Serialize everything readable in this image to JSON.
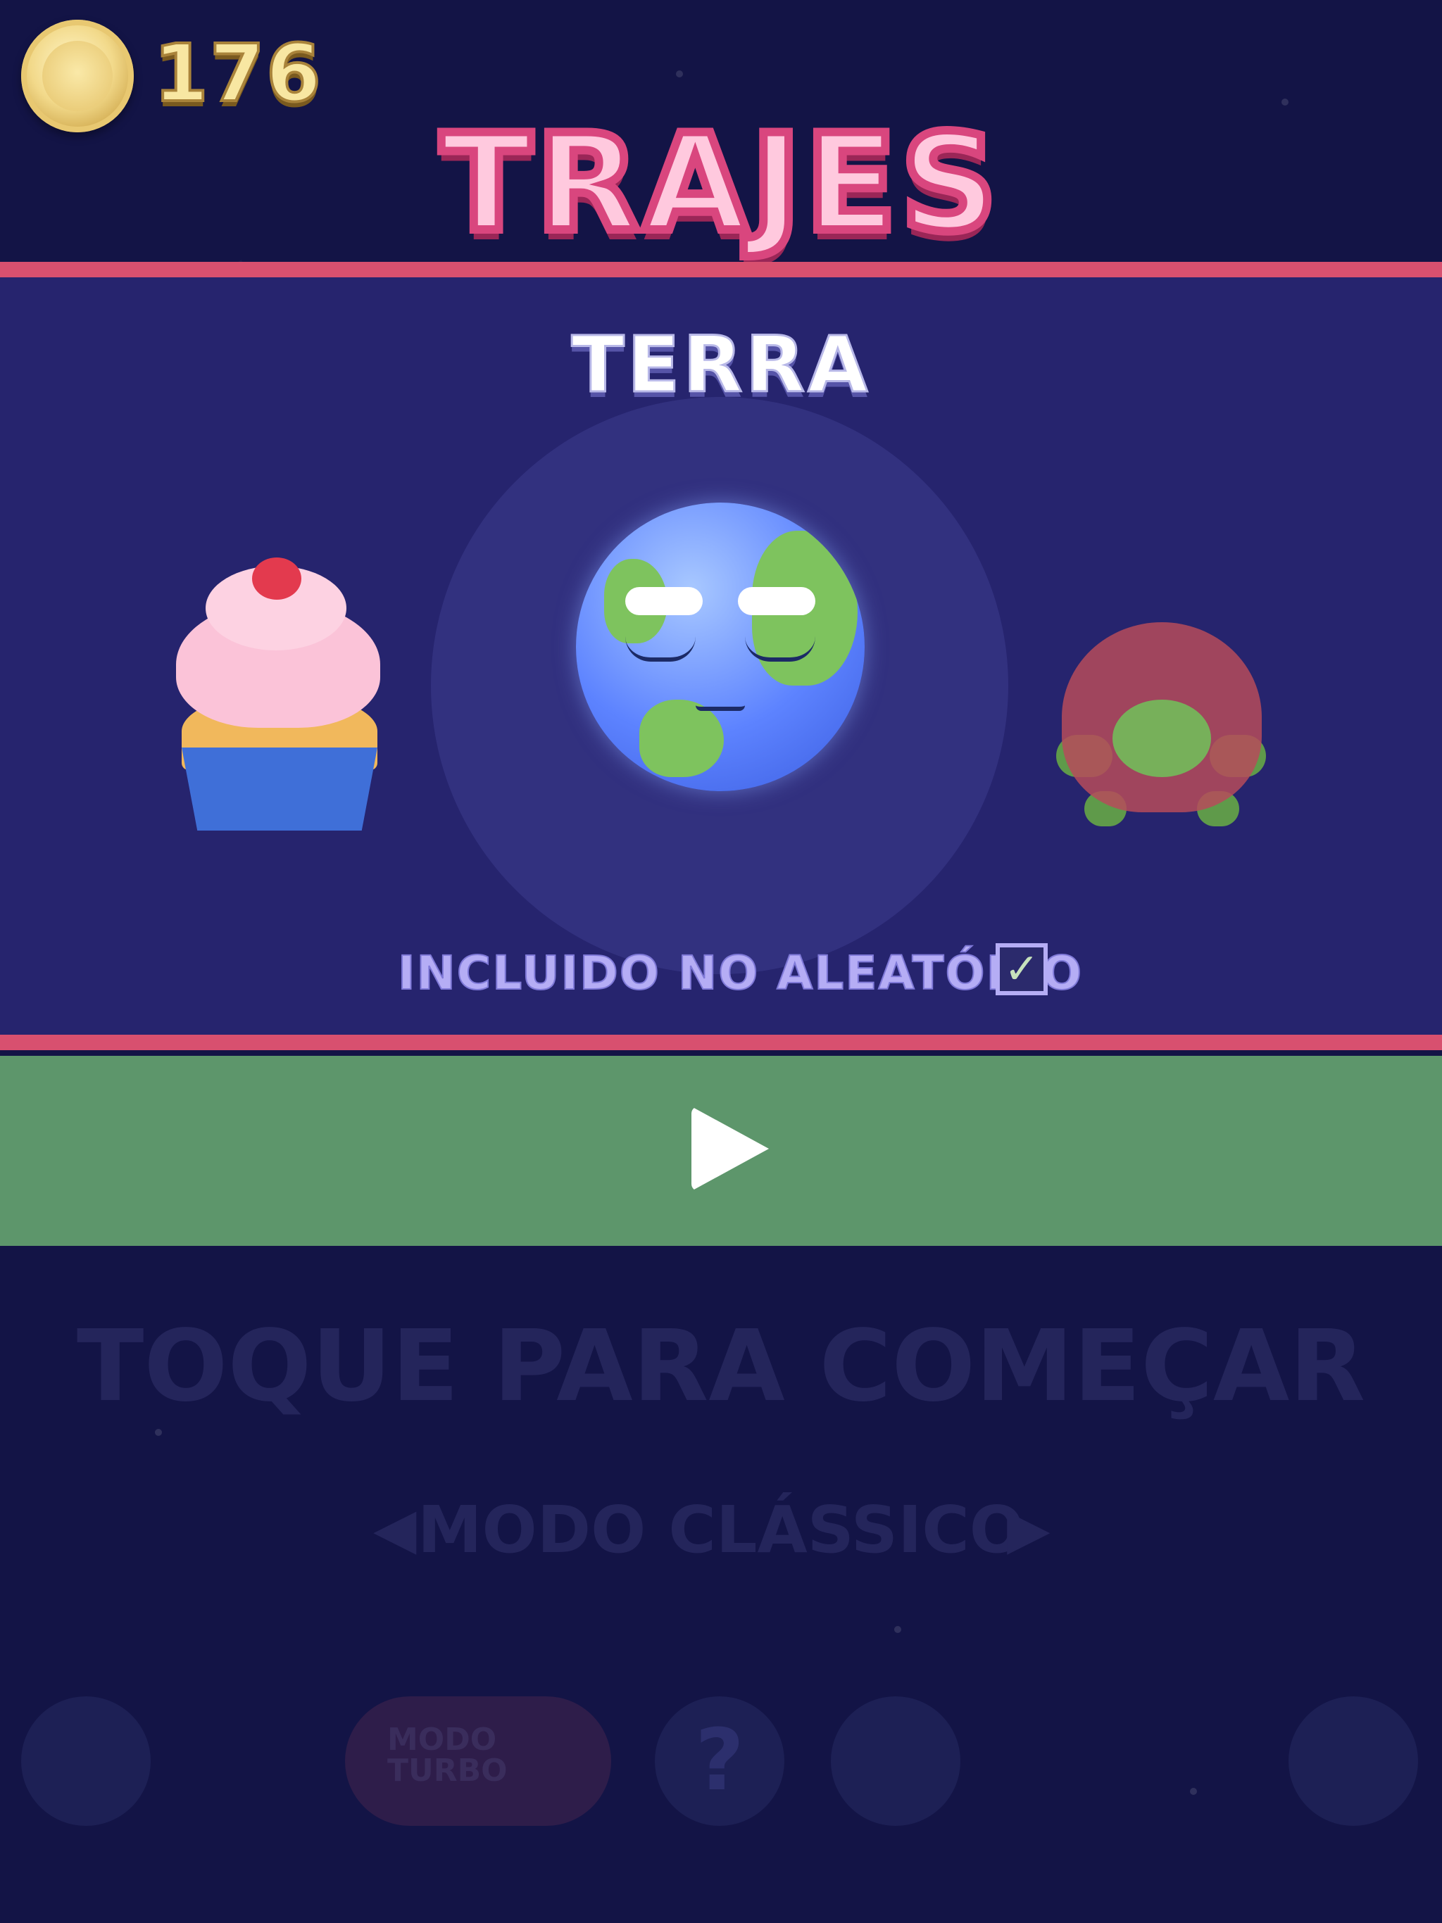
{
  "coins": {
    "count": "176"
  },
  "screen": {
    "title": "TRAJES"
  },
  "costume": {
    "name": "TERRA",
    "random_label": "INCLUIDO NO ALEATÓRIO",
    "random_checked": true,
    "check_mark": "✓"
  },
  "play": {
    "icon": "play-icon"
  },
  "background": {
    "tap_to_start": "TOQUE PARA COMEÇAR",
    "mode_label": "MODO CLÁSSICO",
    "mode_prev": "◀",
    "mode_next": "▶",
    "turbo_line1": "MODO",
    "turbo_line2": "TURBO",
    "help_glyph": "?"
  },
  "colors": {
    "background": "#131446",
    "panel": "#26246e",
    "accent_line": "#d8506f",
    "play_bar": "#5d966b",
    "title_fill": "#ffc9de"
  }
}
